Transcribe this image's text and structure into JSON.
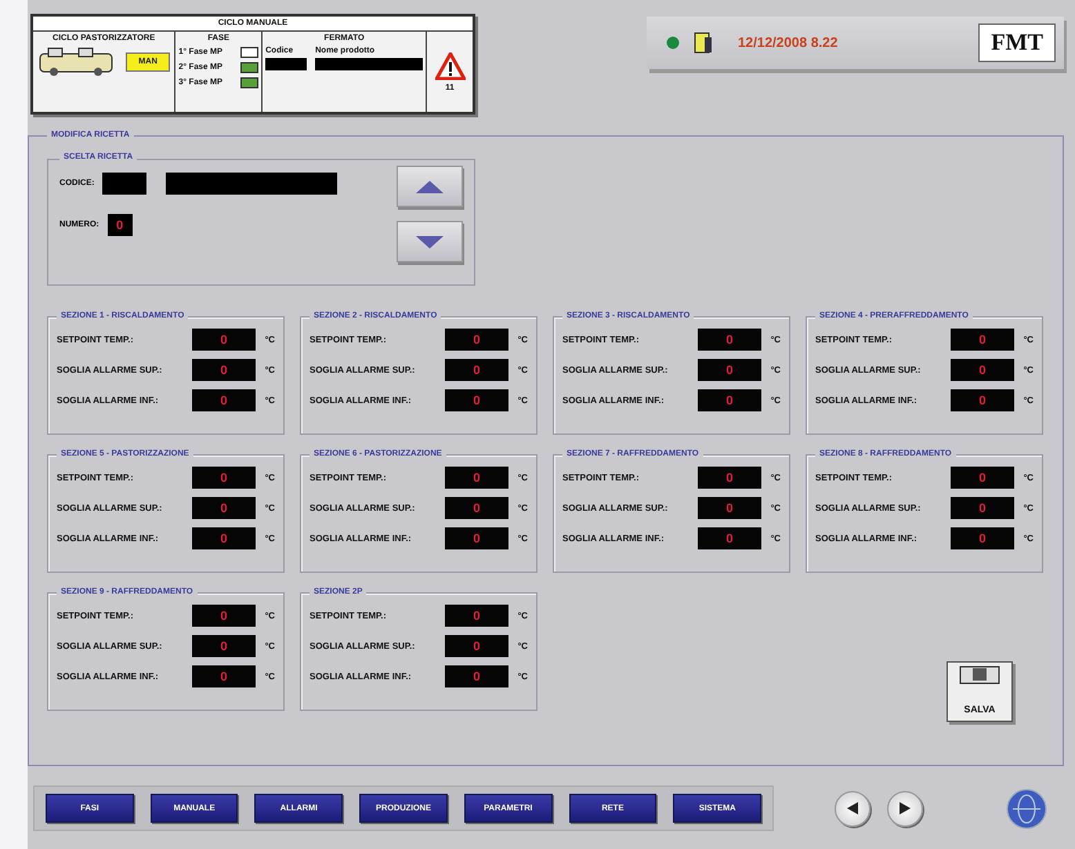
{
  "header": {
    "title": "CICLO MANUALE",
    "cycle_label": "CICLO PASTORIZZATORE",
    "cycle_button": "MAN",
    "phase_label": "FASE",
    "phases": [
      {
        "label": "1° Fase MP",
        "on": false
      },
      {
        "label": "2° Fase MP",
        "on": true
      },
      {
        "label": "3° Fase MP",
        "on": true
      }
    ],
    "state_label": "FERMATO",
    "code_label": "Codice",
    "name_label": "Nome prodotto",
    "alarm_count": "11"
  },
  "status": {
    "datetime": "12/12/2008 8.22",
    "logo": "FMT"
  },
  "recipe_panel": {
    "title": "MODIFICA RICETTA",
    "choice": {
      "title": "SCELTA RICETTA",
      "code_label": "CODICE:",
      "number_label": "NUMERO:",
      "number_value": "0"
    }
  },
  "sections": [
    {
      "title": "SEZIONE 1 - RISCALDAMENTO",
      "rows": [
        {
          "label": "SETPOINT TEMP.:",
          "value": "0",
          "unit": "°C"
        },
        {
          "label": "SOGLIA ALLARME SUP.:",
          "value": "0",
          "unit": "°C"
        },
        {
          "label": "SOGLIA ALLARME INF.:",
          "value": "0",
          "unit": "°C"
        }
      ]
    },
    {
      "title": "SEZIONE 2 - RISCALDAMENTO",
      "rows": [
        {
          "label": "SETPOINT TEMP.:",
          "value": "0",
          "unit": "°C"
        },
        {
          "label": "SOGLIA ALLARME SUP.:",
          "value": "0",
          "unit": "°C"
        },
        {
          "label": "SOGLIA ALLARME INF.:",
          "value": "0",
          "unit": "°C"
        }
      ]
    },
    {
      "title": "SEZIONE 3 - RISCALDAMENTO",
      "rows": [
        {
          "label": "SETPOINT TEMP.:",
          "value": "0",
          "unit": "°C"
        },
        {
          "label": "SOGLIA ALLARME SUP.:",
          "value": "0",
          "unit": "°C"
        },
        {
          "label": "SOGLIA ALLARME INF.:",
          "value": "0",
          "unit": "°C"
        }
      ]
    },
    {
      "title": "SEZIONE 4 - PRERAFFREDDAMENTO",
      "rows": [
        {
          "label": "SETPOINT TEMP.:",
          "value": "0",
          "unit": "°C"
        },
        {
          "label": "SOGLIA ALLARME SUP.:",
          "value": "0",
          "unit": "°C"
        },
        {
          "label": "SOGLIA ALLARME INF.:",
          "value": "0",
          "unit": "°C"
        }
      ]
    },
    {
      "title": "SEZIONE 5 - PASTORIZZAZIONE",
      "rows": [
        {
          "label": "SETPOINT TEMP.:",
          "value": "0",
          "unit": "°C"
        },
        {
          "label": "SOGLIA ALLARME SUP.:",
          "value": "0",
          "unit": "°C"
        },
        {
          "label": "SOGLIA ALLARME INF.:",
          "value": "0",
          "unit": "°C"
        }
      ]
    },
    {
      "title": "SEZIONE 6 - PASTORIZZAZIONE",
      "rows": [
        {
          "label": "SETPOINT TEMP.:",
          "value": "0",
          "unit": "°C"
        },
        {
          "label": "SOGLIA ALLARME SUP.:",
          "value": "0",
          "unit": "°C"
        },
        {
          "label": "SOGLIA ALLARME INF.:",
          "value": "0",
          "unit": "°C"
        }
      ]
    },
    {
      "title": "SEZIONE 7 - RAFFREDDAMENTO",
      "rows": [
        {
          "label": "SETPOINT TEMP.:",
          "value": "0",
          "unit": "°C"
        },
        {
          "label": "SOGLIA ALLARME SUP.:",
          "value": "0",
          "unit": "°C"
        },
        {
          "label": "SOGLIA ALLARME INF.:",
          "value": "0",
          "unit": "°C"
        }
      ]
    },
    {
      "title": "SEZIONE 8 - RAFFREDDAMENTO",
      "rows": [
        {
          "label": "SETPOINT TEMP.:",
          "value": "0",
          "unit": "°C"
        },
        {
          "label": "SOGLIA ALLARME SUP.:",
          "value": "0",
          "unit": "°C"
        },
        {
          "label": "SOGLIA ALLARME INF.:",
          "value": "0",
          "unit": "°C"
        }
      ]
    },
    {
      "title": "SEZIONE 9 - RAFFREDDAMENTO",
      "rows": [
        {
          "label": "SETPOINT TEMP.:",
          "value": "0",
          "unit": "°C"
        },
        {
          "label": "SOGLIA ALLARME SUP.:",
          "value": "0",
          "unit": "°C"
        },
        {
          "label": "SOGLIA ALLARME INF.:",
          "value": "0",
          "unit": "°C"
        }
      ]
    },
    {
      "title": "SEZIONE 2P",
      "rows": [
        {
          "label": "SETPOINT TEMP.:",
          "value": "0",
          "unit": "°C"
        },
        {
          "label": "SOGLIA ALLARME SUP.:",
          "value": "0",
          "unit": "°C"
        },
        {
          "label": "SOGLIA ALLARME INF.:",
          "value": "0",
          "unit": "°C"
        }
      ]
    }
  ],
  "save_button": "SALVA",
  "nav": [
    "FASI",
    "MANUALE",
    "ALLARMI",
    "PRODUZIONE",
    "PARAMETRI",
    "RETE",
    "SISTEMA"
  ]
}
